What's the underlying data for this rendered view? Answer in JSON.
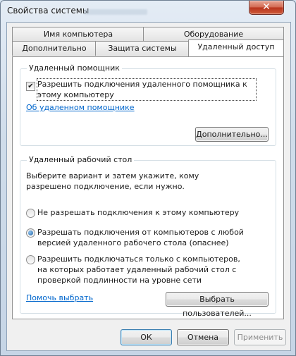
{
  "window": {
    "title": "Свойства системы",
    "close_glyph": "✕"
  },
  "tabs": {
    "row_back": [
      "Имя компьютера",
      "Оборудование"
    ],
    "row_front": [
      "Дополнительно",
      "Защита системы",
      "Удаленный доступ"
    ],
    "active": "Удаленный доступ"
  },
  "remote_assistance": {
    "group_title": "Удаленный помощник",
    "checkbox_label": "Разрешить подключения удаленного помощника к этому компьютеру",
    "checkbox_checked": true,
    "link": "Об удаленном помощнике",
    "advanced_button": "Дополнительно..."
  },
  "remote_desktop": {
    "group_title": "Удаленный рабочий стол",
    "description": "Выберите вариант и затем укажите, кому разрешено подключение, если нужно.",
    "options": [
      "Не разрешать подключения к этому компьютеру",
      "Разрешать подключения от компьютеров с любой версией удаленного рабочего стола (опаснее)",
      "Разрешить подключаться только с компьютеров, на которых работает удаленный рабочий стол с проверкой подлинности на уровне сети"
    ],
    "selected_option": 1,
    "help_link": "Помочь выбрать",
    "select_users_button": "Выбрать пользователей..."
  },
  "footer": {
    "ok": "ОК",
    "cancel": "Отмена",
    "apply": "Применить"
  },
  "icons": {
    "close": "close-icon",
    "check": "checkmark-icon",
    "radio": "radio-icon"
  }
}
